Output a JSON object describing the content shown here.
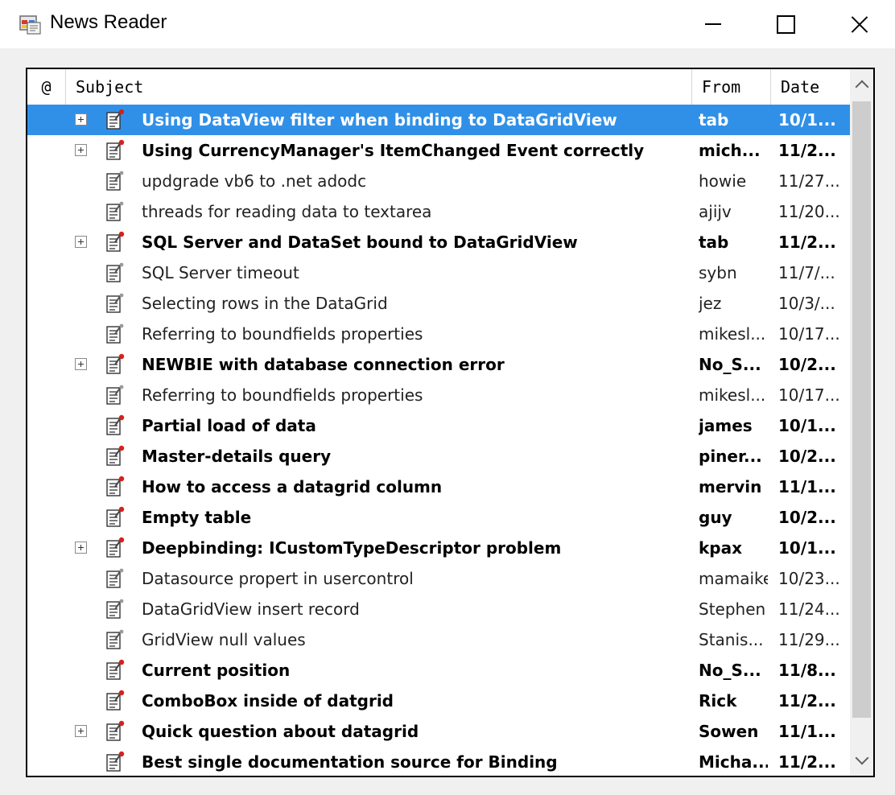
{
  "window": {
    "title": "News Reader",
    "app_icon": "newsreader-app-icon",
    "controls": {
      "minimize": "minimize-icon",
      "maximize": "maximize-icon",
      "close": "close-icon"
    }
  },
  "grid": {
    "columns": {
      "attach": "@",
      "subject": "Subject",
      "from": "From",
      "date": "Date"
    },
    "selected_color": "#3090e8",
    "rows": [
      {
        "subject": "Using DataView filter when binding to DataGridView",
        "from": "tab",
        "date": "10/1...",
        "bold": true,
        "expandable": true,
        "unread": true,
        "selected": true
      },
      {
        "subject": "Using CurrencyManager's ItemChanged Event correctly",
        "from": "mich...",
        "date": "11/2...",
        "bold": true,
        "expandable": true,
        "unread": true
      },
      {
        "subject": "updgrade vb6 to .net adodc",
        "from": "howie",
        "date": "11/27...",
        "bold": false,
        "expandable": false,
        "unread": false
      },
      {
        "subject": "threads for reading data to textarea",
        "from": "ajijv",
        "date": "11/20...",
        "bold": false,
        "expandable": false,
        "unread": false
      },
      {
        "subject": "SQL Server and DataSet bound to DataGridView",
        "from": "tab",
        "date": "11/2...",
        "bold": true,
        "expandable": true,
        "unread": true
      },
      {
        "subject": "SQL Server timeout",
        "from": "sybn",
        "date": "11/7/...",
        "bold": false,
        "expandable": false,
        "unread": false
      },
      {
        "subject": "Selecting rows in the DataGrid",
        "from": "jez",
        "date": "10/3/...",
        "bold": false,
        "expandable": false,
        "unread": false
      },
      {
        "subject": "Referring to boundfields properties",
        "from": "mikesl...",
        "date": "10/17...",
        "bold": false,
        "expandable": false,
        "unread": false
      },
      {
        "subject": "NEWBIE with database connection error",
        "from": "No_S...",
        "date": "10/2...",
        "bold": true,
        "expandable": true,
        "unread": true
      },
      {
        "subject": "Referring to boundfields properties",
        "from": "mikesl...",
        "date": "10/17...",
        "bold": false,
        "expandable": false,
        "unread": false
      },
      {
        "subject": "Partial load of data",
        "from": "james",
        "date": "10/1...",
        "bold": true,
        "expandable": false,
        "unread": true
      },
      {
        "subject": "Master-details query",
        "from": "piner...",
        "date": "10/2...",
        "bold": true,
        "expandable": false,
        "unread": true
      },
      {
        "subject": "How to access a datagrid column",
        "from": "mervin",
        "date": "11/1...",
        "bold": true,
        "expandable": false,
        "unread": true
      },
      {
        "subject": "Empty table",
        "from": "guy",
        "date": "10/2...",
        "bold": true,
        "expandable": false,
        "unread": true
      },
      {
        "subject": "Deepbinding: ICustomTypeDescriptor problem",
        "from": "kpax",
        "date": "10/1...",
        "bold": true,
        "expandable": true,
        "unread": true
      },
      {
        "subject": "Datasource propert in usercontrol",
        "from": "mamaike",
        "date": "10/23...",
        "bold": false,
        "expandable": false,
        "unread": false
      },
      {
        "subject": "DataGridView insert record",
        "from": "Stephen",
        "date": "11/24...",
        "bold": false,
        "expandable": false,
        "unread": false
      },
      {
        "subject": "GridView null values",
        "from": "Stanis...",
        "date": "11/29...",
        "bold": false,
        "expandable": false,
        "unread": false
      },
      {
        "subject": "Current position",
        "from": "No_S...",
        "date": "11/8...",
        "bold": true,
        "expandable": false,
        "unread": true
      },
      {
        "subject": "ComboBox inside of datgrid",
        "from": "Rick",
        "date": "11/2...",
        "bold": true,
        "expandable": false,
        "unread": true
      },
      {
        "subject": "Quick question about datagrid",
        "from": "Sowen",
        "date": "11/1...",
        "bold": true,
        "expandable": true,
        "unread": true
      },
      {
        "subject": "Best single documentation source for Binding",
        "from": "Micha...",
        "date": "11/2...",
        "bold": true,
        "expandable": false,
        "unread": true
      }
    ]
  }
}
